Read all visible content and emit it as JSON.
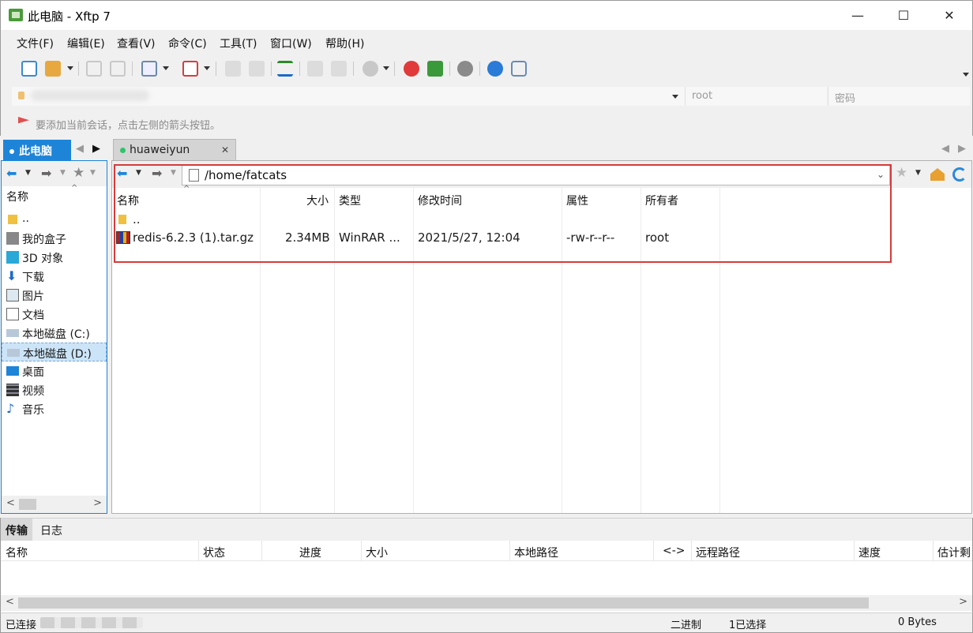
{
  "window": {
    "title": "此电脑 - Xftp 7",
    "minimize": "—",
    "maximize": "☐",
    "close": "✕"
  },
  "menu": [
    "文件(F)",
    "编辑(E)",
    "查看(V)",
    "命令(C)",
    "工具(T)",
    "窗口(W)",
    "帮助(H)"
  ],
  "address": {
    "user_placeholder": "root",
    "password_placeholder": "密码"
  },
  "hint": "要添加当前会话，点击左侧的箭头按钮。",
  "left": {
    "tab": "此电脑",
    "header": "名称",
    "items": [
      {
        "label": "..",
        "icon": "folder-icon"
      },
      {
        "label": "我的盒子",
        "icon": "box-icon"
      },
      {
        "label": "3D 对象",
        "icon": "cube-icon"
      },
      {
        "label": "下载",
        "icon": "download-icon"
      },
      {
        "label": "图片",
        "icon": "picture-icon"
      },
      {
        "label": "文档",
        "icon": "document-icon"
      },
      {
        "label": "本地磁盘 (C:)",
        "icon": "drive-icon"
      },
      {
        "label": "本地磁盘 (D:)",
        "icon": "drive-icon"
      },
      {
        "label": "桌面",
        "icon": "desktop-icon"
      },
      {
        "label": "视频",
        "icon": "video-icon"
      },
      {
        "label": "音乐",
        "icon": "music-icon"
      }
    ]
  },
  "right": {
    "tab": "huaweiyun",
    "path": "/home/fatcats",
    "columns": [
      "名称",
      "大小",
      "类型",
      "修改时间",
      "属性",
      "所有者"
    ],
    "rows": [
      {
        "name": "..",
        "size": "",
        "type": "",
        "mtime": "",
        "attr": "",
        "owner": ""
      },
      {
        "name": "redis-6.2.3 (1).tar.gz",
        "size": "2.34MB",
        "type": "WinRAR ...",
        "mtime": "2021/5/27, 12:04",
        "attr": "-rw-r--r--",
        "owner": "root"
      }
    ]
  },
  "transfer": {
    "tabs": [
      "传输",
      "日志"
    ],
    "columns": [
      "名称",
      "状态",
      "进度",
      "大小",
      "本地路径",
      "<->",
      "远程路径",
      "速度",
      "估计剩"
    ]
  },
  "status": {
    "connected": "已连接",
    "mode": "二进制",
    "selection": "1已选择",
    "bytes": "0 Bytes"
  }
}
